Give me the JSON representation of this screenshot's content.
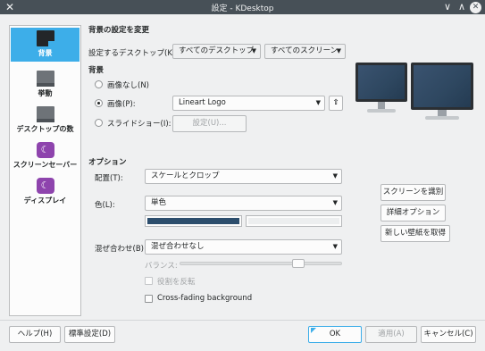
{
  "window": {
    "title": "設定 - KDesktop",
    "close_left": "✕",
    "min": "∨",
    "max": "∧",
    "close": "✕"
  },
  "sidebar": {
    "items": [
      {
        "label": "背景",
        "icon": "desktop-icon",
        "selected": true
      },
      {
        "label": "挙動",
        "icon": "window-icon"
      },
      {
        "label": "デスクトップの数",
        "icon": "virtual-desktops-icon"
      },
      {
        "label": "スクリーンセーバー",
        "icon": "screensaver-icon"
      },
      {
        "label": "ディスプレイ",
        "icon": "display-icon"
      }
    ]
  },
  "header": {
    "title": "背景の設定を変更"
  },
  "desktop_row": {
    "label": "設定するデスクトップ(K):",
    "desktop_select": "すべてのデスクトップ",
    "screen_select": "すべてのスクリーン"
  },
  "background": {
    "title": "背景",
    "no_image": "画像なし(N)",
    "image": "画像(P):",
    "image_value": "Lineart Logo",
    "upload_icon": "⇧",
    "slideshow": "スライドショー(I):",
    "slideshow_settings": "設定(U)..."
  },
  "options": {
    "title": "オプション",
    "placement_label": "配置(T):",
    "placement_value": "スケールとクロップ",
    "color_label": "色(L):",
    "color_value": "単色",
    "color_primary": "#2c4e6d",
    "blend_label": "混ぜ合わせ(B):",
    "blend_value": "混ぜ合わせなし",
    "balance_label": "バランス:",
    "balance_value": 0.75,
    "reverse_roles": "役割を反転",
    "crossfade": "Cross-fading background"
  },
  "right_buttons": {
    "identify": "スクリーンを識別",
    "advanced": "詳細オプション",
    "get_new": "新しい壁紙を取得"
  },
  "footer": {
    "help": "ヘルプ(H)",
    "defaults": "標準設定(D)",
    "ok": "OK",
    "apply": "適用(A)",
    "cancel": "キャンセル(C)"
  }
}
